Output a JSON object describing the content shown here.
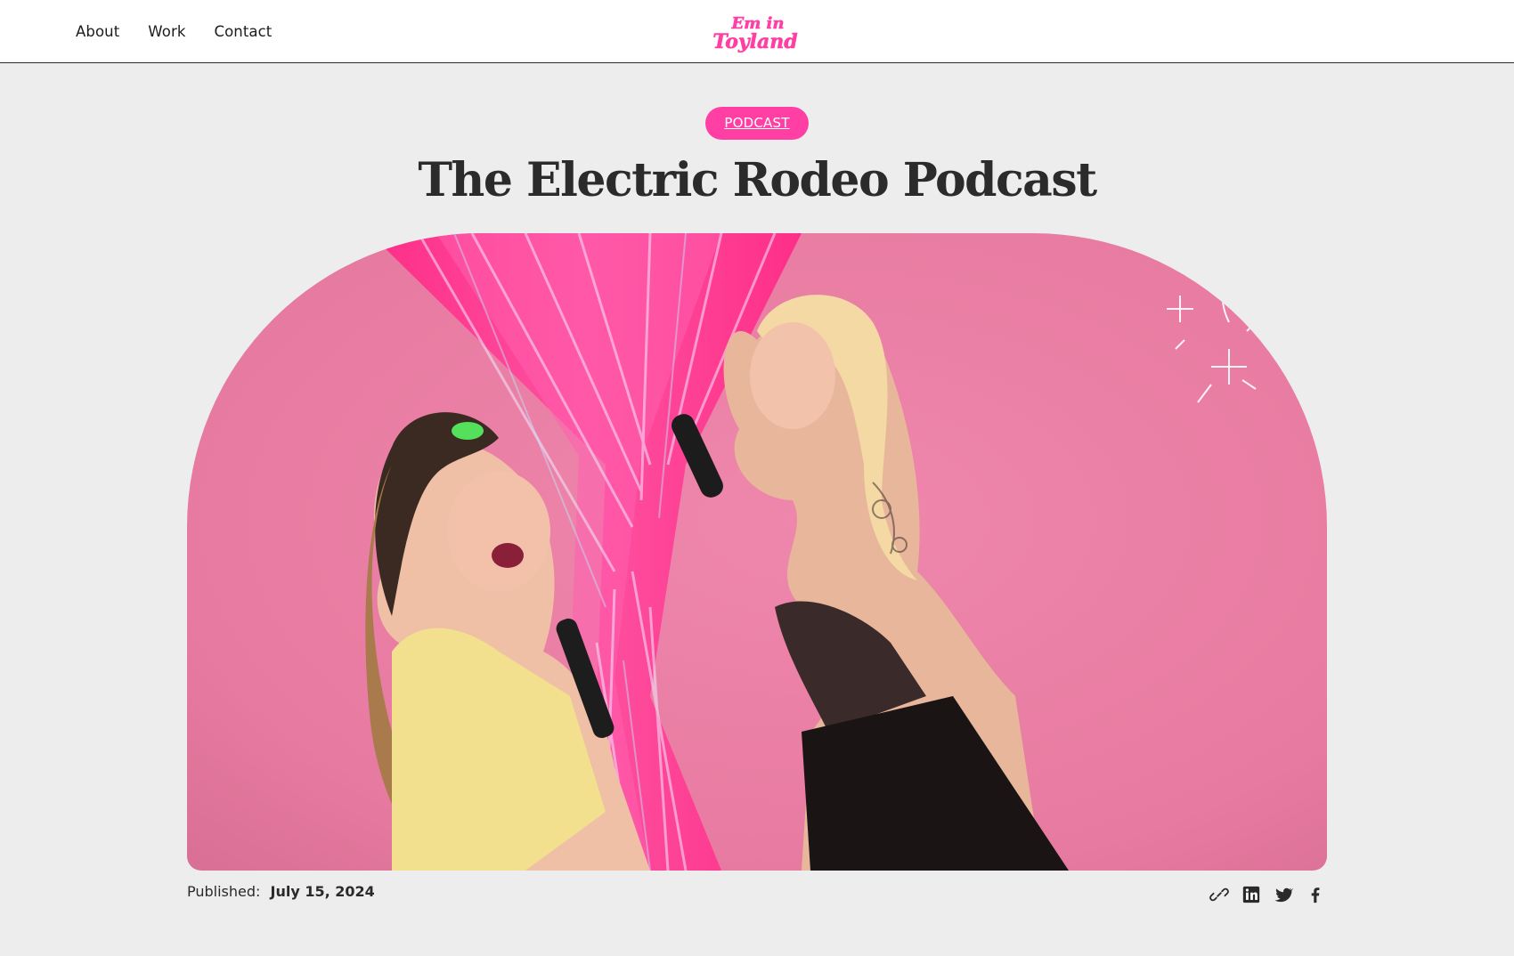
{
  "nav": {
    "items": [
      "About",
      "Work",
      "Contact"
    ]
  },
  "logo": {
    "line1": "Em in",
    "line2": "Toyland",
    "color": "#ff3fa4"
  },
  "post": {
    "category": "PODCAST",
    "title": "The Electric Rodeo Podcast",
    "published_label": "Published:",
    "published_date": "July 15, 2024"
  },
  "share": {
    "icons": [
      "link-icon",
      "linkedin-icon",
      "twitter-icon",
      "facebook-icon"
    ]
  },
  "colors": {
    "accent": "#ff3fa4",
    "background": "#ededed",
    "hero_pink": "#e97ea4"
  }
}
